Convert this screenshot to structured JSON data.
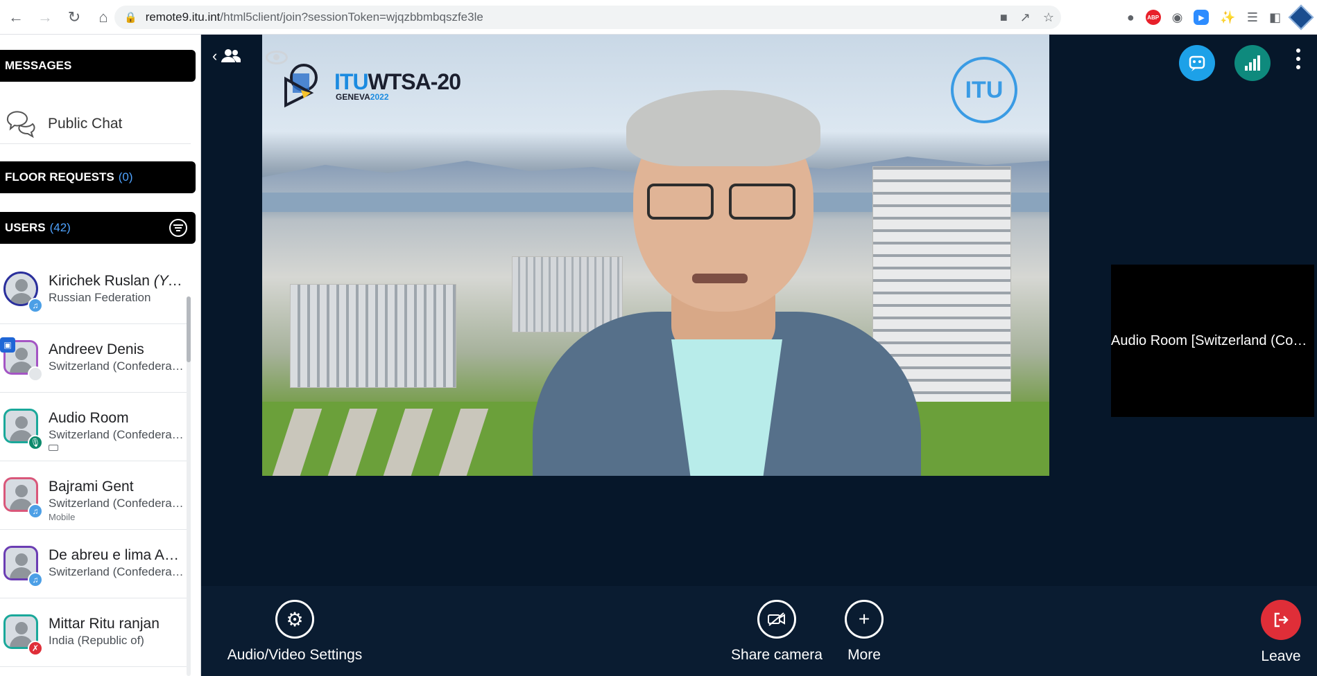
{
  "browser": {
    "url_host": "remote9.itu.int",
    "url_path": "/html5client/join?sessionToken=wjqzbbmbqszfe3le",
    "ext_abp": "ABP"
  },
  "sidebar": {
    "messages_header": "MESSAGES",
    "public_chat": "Public Chat",
    "floor_requests_label": "FLOOR REQUESTS",
    "floor_requests_count": "(0)",
    "users_label": "USERS",
    "users_count": "(42)",
    "users": [
      {
        "name": "Kirichek Ruslan",
        "you": "(You)",
        "country": "Russian Federation",
        "sub": "",
        "badge": "headset"
      },
      {
        "name": "Andreev Denis",
        "you": "",
        "country": "Switzerland (Confederation of)",
        "sub": "",
        "badge": "none"
      },
      {
        "name": "Audio Room",
        "you": "",
        "country": "Switzerland (Confederation of)",
        "sub": "",
        "badge": "mic"
      },
      {
        "name": "Bajrami Gent",
        "you": "",
        "country": "Switzerland (Confederation of)",
        "sub": "Mobile",
        "badge": "headset"
      },
      {
        "name": "De abreu e lima Antonio",
        "you": "",
        "country": "Switzerland (Confederation of)",
        "sub": "",
        "badge": "headset"
      },
      {
        "name": "Mittar Ritu ranjan",
        "you": "",
        "country": "India (Republic of)",
        "sub": "",
        "badge": "muted"
      }
    ]
  },
  "stage": {
    "logo_title_a": "ITU",
    "logo_title_b": "WTSA-20",
    "logo_sub_a": "GENEVA",
    "logo_sub_b": "2022",
    "itu_logo": "ITU",
    "audio_tile_name": "Audio Room [Switzerland (Confederation of)]"
  },
  "controls": {
    "av_settings": "Audio/Video Settings",
    "share_camera": "Share camera",
    "more": "More",
    "leave": "Leave"
  },
  "colors": {
    "stage_bg": "#06172a",
    "accent_blue": "#1da1e8",
    "leave_red": "#df2e38",
    "connection_teal": "#0e8a7d"
  }
}
